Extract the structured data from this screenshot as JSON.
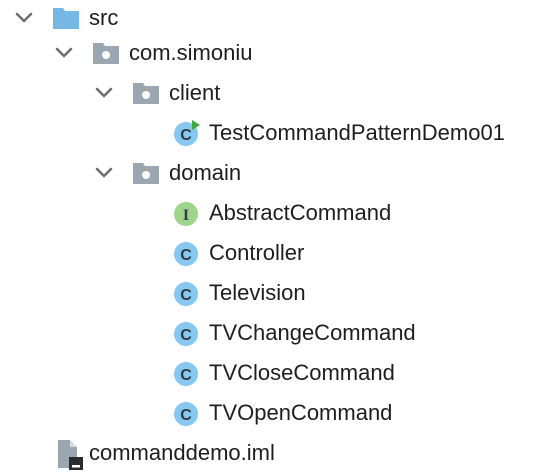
{
  "tree": {
    "src": {
      "label": "src",
      "icon": "source-folder-icon",
      "expanded": true
    },
    "package": {
      "label": "com.simoniu",
      "icon": "package-folder-icon",
      "expanded": true
    },
    "client": {
      "label": "client",
      "icon": "package-folder-icon",
      "expanded": true,
      "children": [
        {
          "label": "TestCommandPatternDemo01",
          "icon": "runnable-class-icon",
          "glyph": "C"
        }
      ]
    },
    "domain": {
      "label": "domain",
      "icon": "package-folder-icon",
      "expanded": true,
      "children": [
        {
          "label": "AbstractCommand",
          "icon": "interface-icon",
          "glyph": "I"
        },
        {
          "label": "Controller",
          "icon": "class-icon",
          "glyph": "C"
        },
        {
          "label": "Television",
          "icon": "class-icon",
          "glyph": "C"
        },
        {
          "label": "TVChangeCommand",
          "icon": "class-icon",
          "glyph": "C"
        },
        {
          "label": "TVCloseCommand",
          "icon": "class-icon",
          "glyph": "C"
        },
        {
          "label": "TVOpenCommand",
          "icon": "class-icon",
          "glyph": "C"
        }
      ]
    },
    "file": {
      "label": "commanddemo.iml",
      "icon": "iml-file-icon"
    }
  },
  "colors": {
    "chevron": "#6e6e6e",
    "source_folder": "#75b8e6",
    "package_folder": "#9aa7b0",
    "package_dot": "#ffffff",
    "class_circle": "#86c8ef",
    "interface_circle": "#9ed58a",
    "glyph": "#2e3a44",
    "run_triangle": "#3fa642",
    "file_gray": "#9aa7b0",
    "file_dark": "#2b2b2b"
  }
}
